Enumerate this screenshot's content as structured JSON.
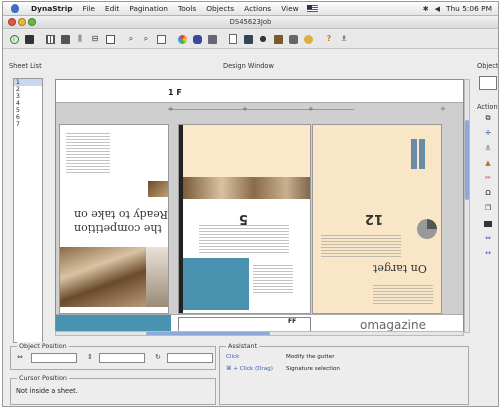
{
  "menubar": {
    "app": "DynaStrip",
    "items": [
      "File",
      "Edit",
      "Pagination",
      "Tools",
      "Objects",
      "Actions",
      "View"
    ],
    "clock": "Thu 5:06 PM"
  },
  "window": {
    "title": "DS45623Job"
  },
  "labels": {
    "sheet_list": "Sheet List",
    "design_window": "Design Window",
    "object": "Object",
    "actions": "Actions"
  },
  "sheets": [
    "1",
    "2",
    "3",
    "4",
    "5",
    "6",
    "7"
  ],
  "canvas": {
    "page_label": "1 F",
    "left_headline_1": "Ready to take on",
    "left_headline_2": "the competition",
    "mid_number": "5",
    "right_number": "12",
    "right_headline": "On target",
    "small_tag": "FF",
    "magazine": "omagazine"
  },
  "panels": {
    "object_position": "Object Position",
    "cursor_position": "Cursor Position",
    "cursor_text": "Not inside a sheet.",
    "assistant": "Assistant",
    "assistant_rows": [
      {
        "key": "Click",
        "desc": "Modify the gutter"
      },
      {
        "key": "⌘ + Click (Drag)",
        "desc": "Signature selection"
      }
    ]
  },
  "colors": {
    "teal": "#4a93b0",
    "peach": "#f8e6c6",
    "selection": "#c7d8ef"
  }
}
